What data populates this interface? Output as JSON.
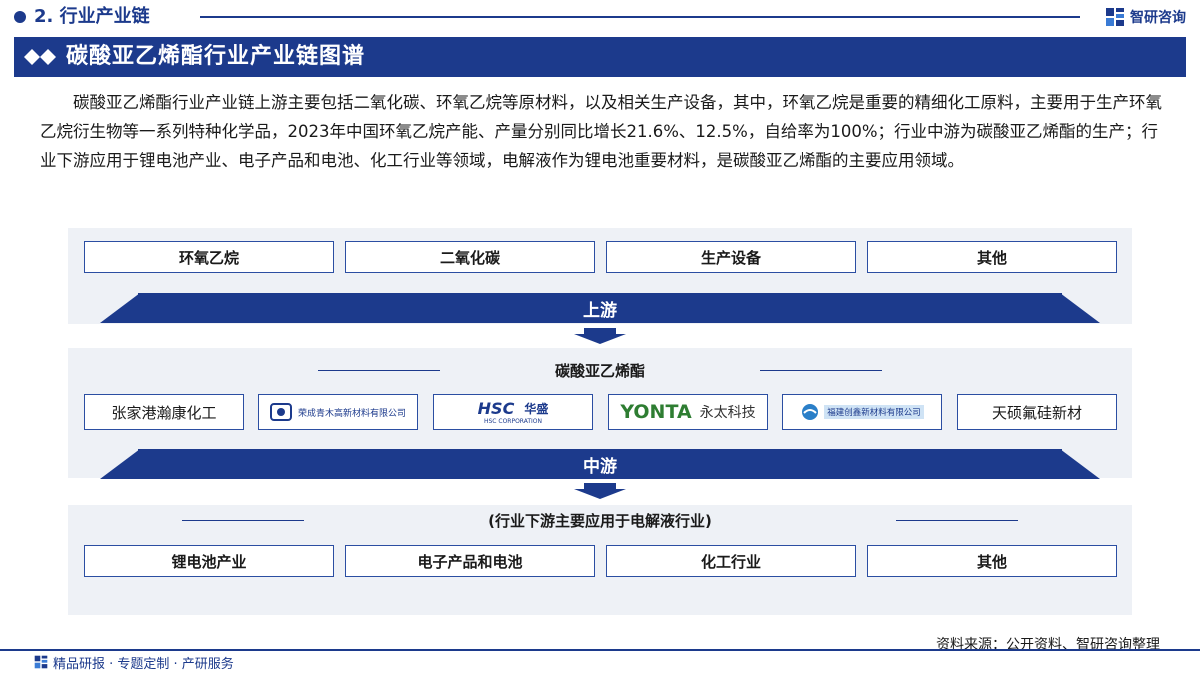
{
  "header": {
    "section_label": "2. 行业产业链",
    "brand_name": "智研咨询"
  },
  "title": "碳酸亚乙烯酯行业产业链图谱",
  "description": "碳酸亚乙烯酯行业产业链上游主要包括二氧化碳、环氧乙烷等原材料，以及相关生产设备，其中，环氧乙烷是重要的精细化工原料，主要用于生产环氧乙烷衍生物等一系列特种化学品，2023年中国环氧乙烷产能、产量分别同比增长21.6%、12.5%，自给率为100%；行业中游为碳酸亚乙烯酯的生产；行业下游应用于锂电池产业、电子产品和电池、化工行业等领域，电解液作为锂电池重要材料，是碳酸亚乙烯酯的主要应用领域。",
  "upstream": {
    "items": [
      "环氧乙烷",
      "二氧化碳",
      "生产设备",
      "其他"
    ],
    "stage_label": "上游"
  },
  "midstream": {
    "label": "碳酸亚乙烯酯",
    "company_1": "张家港瀚康化工",
    "logo_2_text": "荣成青木高新材料有限公司",
    "logo_3_text_a": "HSC",
    "logo_3_text_b": "华盛",
    "logo_3_text_c": "HSC CORPORATION",
    "logo_4_text_a": "YONTA",
    "logo_4_text_b": "永太科技",
    "logo_5_text": "福建创鑫新材料有限公司",
    "company_6": "天硕氟硅新材",
    "stage_label": "中游"
  },
  "downstream": {
    "label": "(行业下游主要应用于电解液行业)",
    "items": [
      "锂电池产业",
      "电子产品和电池",
      "化工行业",
      "其他"
    ]
  },
  "footer": {
    "source": "资料来源：公开资料、智研咨询整理",
    "tagline": "精品研报 · 专题定制 · 产研服务"
  },
  "colors": {
    "primary": "#1c3a8c",
    "band": "#eef1f6",
    "box_border": "#2b4ea2"
  }
}
